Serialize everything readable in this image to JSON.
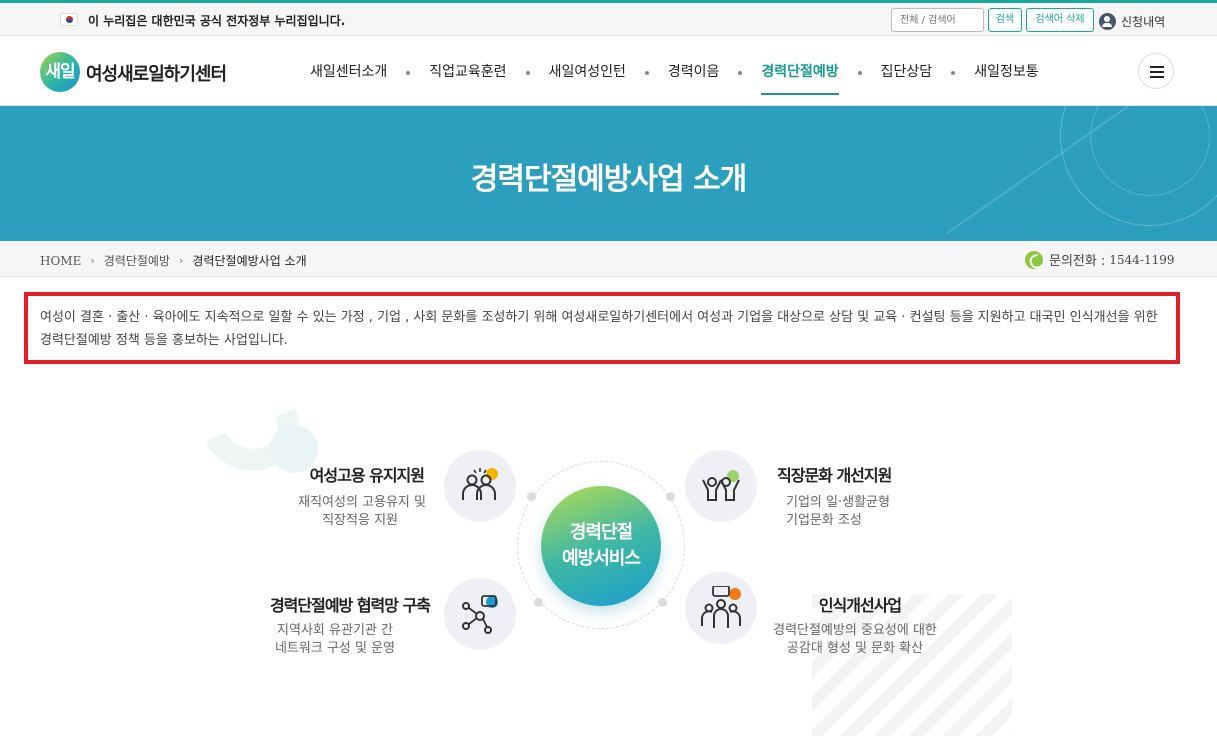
{
  "gov_bar": {
    "notice": "이 누리집은 대한민국 공식 전자정부 누리집입니다.",
    "search_placeholder": "전체 / 검색어",
    "search_button": "검색",
    "clear_button": "검색어 삭제",
    "user_link": "신청내역"
  },
  "header": {
    "logo_mark": "새일",
    "logo_text": "여성새로일하기센터",
    "nav": [
      {
        "label": "새일센터소개"
      },
      {
        "label": "직업교육훈련"
      },
      {
        "label": "새일여성인턴"
      },
      {
        "label": "경력이음"
      },
      {
        "label": "경력단절예방"
      },
      {
        "label": "집단상담"
      },
      {
        "label": "새일정보통"
      }
    ],
    "active_nav": "경력단절예방"
  },
  "banner": {
    "title": "경력단절예방사업 소개"
  },
  "breadcrumb": {
    "home": "HOME",
    "level1": "경력단절예방",
    "current": "경력단절예방사업 소개"
  },
  "contact": {
    "label": "문의전화 :",
    "number": "1544-1199"
  },
  "intro": {
    "text": "여성이 결혼 · 출산 · 육아에도 지속적으로 일할 수 있는 가정 , 기업 , 사회 문화를 조성하기 위해 여성새로일하기센터에서 여성과 기업을 대상으로 상담 및 교육 · 컨설팅 등을 지원하고 대국민 인식개선을 위한 경력단절예방 정책 등을 홍보하는 사업입니다."
  },
  "infographic": {
    "center": {
      "line1": "경력단절",
      "line2": "예방서비스"
    },
    "services": [
      {
        "title": "여성고용 유지지원",
        "desc1": "재직여성의 고용유지  및",
        "desc2": "직장적응 지원"
      },
      {
        "title": "직장문화 개선지원",
        "desc1": "기업의 일·생활균형",
        "desc2": "기업문화 조성"
      },
      {
        "title": "경력단절예방 협력망 구축",
        "desc1": "지역사회 유관기관 간",
        "desc2": "네트워크 구성 및 운영"
      },
      {
        "title": "인식개선사업",
        "desc1": "경력단절예방의 중요성에 대한",
        "desc2": "공감대 형성 및 문화 확산"
      }
    ]
  },
  "colors": {
    "brand_teal": "#1a9a8c",
    "banner_blue": "#2c9fbf",
    "highlight_red": "#e01e2a"
  }
}
